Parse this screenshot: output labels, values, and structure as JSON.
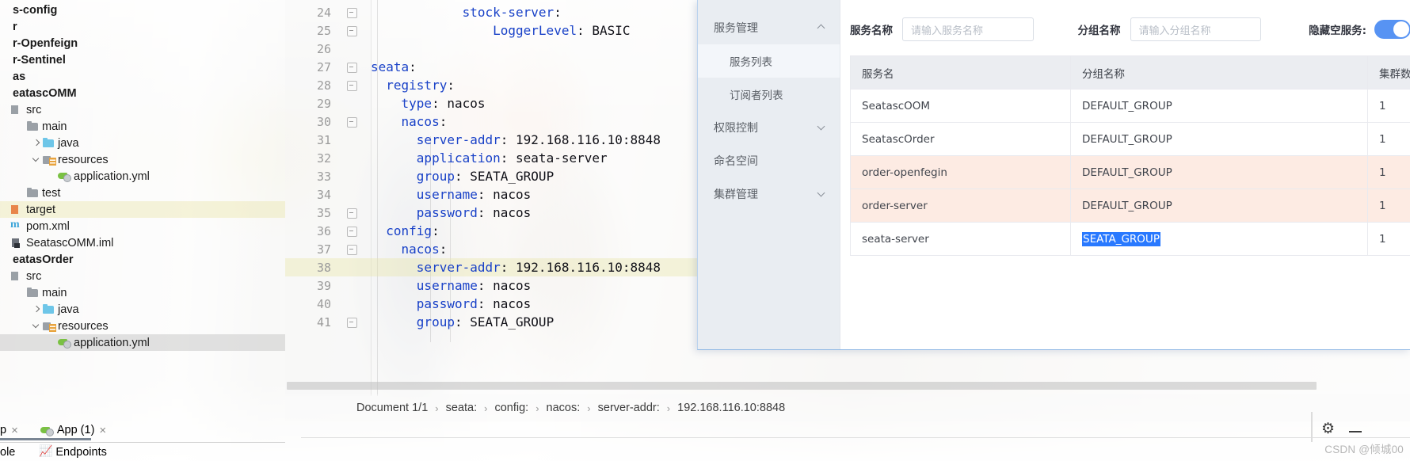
{
  "ide": {
    "project_tree": [
      {
        "label": "s-config",
        "indent": 0,
        "bold": true,
        "icon": "none",
        "chevron": "none",
        "state": "normal"
      },
      {
        "label": "r",
        "indent": 0,
        "bold": true,
        "icon": "none",
        "chevron": "none",
        "state": "normal"
      },
      {
        "label": "r-Openfeign",
        "indent": 0,
        "bold": true,
        "icon": "none",
        "chevron": "none",
        "state": "normal"
      },
      {
        "label": "r-Sentinel",
        "indent": 0,
        "bold": true,
        "icon": "none",
        "chevron": "none",
        "state": "normal"
      },
      {
        "label": "as",
        "indent": 0,
        "bold": true,
        "icon": "none",
        "chevron": "none",
        "state": "normal"
      },
      {
        "label": "eatascOMM",
        "indent": 0,
        "bold": true,
        "icon": "none",
        "chevron": "none",
        "state": "normal"
      },
      {
        "label": "src",
        "indent": 1,
        "bold": false,
        "icon": "src",
        "chevron": "none",
        "state": "normal"
      },
      {
        "label": "main",
        "indent": 2,
        "bold": false,
        "icon": "folder",
        "chevron": "none",
        "state": "normal"
      },
      {
        "label": "java",
        "indent": 3,
        "bold": false,
        "icon": "folder-blue",
        "chevron": "right",
        "state": "normal"
      },
      {
        "label": "resources",
        "indent": 3,
        "bold": false,
        "icon": "resources",
        "chevron": "down",
        "state": "normal"
      },
      {
        "label": "application.yml",
        "indent": 4,
        "bold": false,
        "icon": "yml",
        "chevron": "none",
        "state": "normal"
      },
      {
        "label": "test",
        "indent": 2,
        "bold": false,
        "icon": "folder",
        "chevron": "none",
        "state": "normal"
      },
      {
        "label": "target",
        "indent": 1,
        "bold": false,
        "icon": "target",
        "chevron": "none",
        "state": "highlight"
      },
      {
        "label": "pom.xml",
        "indent": 1,
        "bold": false,
        "icon": "xml",
        "chevron": "none",
        "state": "normal"
      },
      {
        "label": "SeatascOMM.iml",
        "indent": 1,
        "bold": false,
        "icon": "iml",
        "chevron": "none",
        "state": "normal"
      },
      {
        "label": "eatasOrder",
        "indent": 0,
        "bold": true,
        "icon": "none",
        "chevron": "none",
        "state": "normal"
      },
      {
        "label": "src",
        "indent": 1,
        "bold": false,
        "icon": "src",
        "chevron": "none",
        "state": "normal"
      },
      {
        "label": "main",
        "indent": 2,
        "bold": false,
        "icon": "folder",
        "chevron": "none",
        "state": "normal"
      },
      {
        "label": "java",
        "indent": 3,
        "bold": false,
        "icon": "folder-blue",
        "chevron": "right",
        "state": "normal"
      },
      {
        "label": "resources",
        "indent": 3,
        "bold": false,
        "icon": "resources",
        "chevron": "down",
        "state": "normal"
      },
      {
        "label": "application.yml",
        "indent": 4,
        "bold": false,
        "icon": "yml",
        "chevron": "none",
        "state": "selected"
      }
    ],
    "tab_bar": {
      "truncated_tab": "p",
      "app_tab": "App (1)",
      "close_glyph": "×"
    },
    "bottom_strip": {
      "left_label": "ole",
      "endpoints_label": "Endpoints"
    },
    "code_lines": [
      {
        "num": "24",
        "indent": 6,
        "text": "stock-server:",
        "key": "stock-server",
        "value": "",
        "fold": true,
        "highlight": false
      },
      {
        "num": "25",
        "indent": 8,
        "text": "LoggerLevel: BASIC",
        "key": "LoggerLevel",
        "value": " BASIC",
        "fold": true,
        "highlight": false
      },
      {
        "num": "26",
        "indent": 0,
        "text": "",
        "key": "",
        "value": "",
        "fold": false,
        "highlight": false
      },
      {
        "num": "27",
        "indent": 0,
        "text": "seata:",
        "key": "seata",
        "value": "",
        "fold": true,
        "highlight": false
      },
      {
        "num": "28",
        "indent": 1,
        "text": "registry:",
        "key": "registry",
        "value": "",
        "fold": true,
        "highlight": false
      },
      {
        "num": "29",
        "indent": 2,
        "text": "type: nacos",
        "key": "type",
        "value": " nacos",
        "fold": false,
        "highlight": false
      },
      {
        "num": "30",
        "indent": 2,
        "text": "nacos:",
        "key": "nacos",
        "value": "",
        "fold": true,
        "highlight": false
      },
      {
        "num": "31",
        "indent": 3,
        "text": "server-addr: 192.168.116.10:8848",
        "key": "server-addr",
        "value": " 192.168.116.10:8848",
        "fold": false,
        "highlight": false
      },
      {
        "num": "32",
        "indent": 3,
        "text": "application: seata-server",
        "key": "application",
        "value": " seata-server",
        "fold": false,
        "highlight": false
      },
      {
        "num": "33",
        "indent": 3,
        "text": "group: SEATA_GROUP",
        "key": "group",
        "value": " SEATA_GROUP",
        "fold": false,
        "highlight": false
      },
      {
        "num": "34",
        "indent": 3,
        "text": "username: nacos",
        "key": "username",
        "value": " nacos",
        "fold": false,
        "highlight": false
      },
      {
        "num": "35",
        "indent": 3,
        "text": "password: nacos",
        "key": "password",
        "value": " nacos",
        "fold": true,
        "highlight": false
      },
      {
        "num": "36",
        "indent": 1,
        "text": "config:",
        "key": "config",
        "value": "",
        "fold": true,
        "highlight": false
      },
      {
        "num": "37",
        "indent": 2,
        "text": "nacos:",
        "key": "nacos",
        "value": "",
        "fold": true,
        "highlight": false
      },
      {
        "num": "38",
        "indent": 3,
        "text": "server-addr: 192.168.116.10:8848",
        "key": "server-addr",
        "value": " 192.168.116.10:8848",
        "fold": false,
        "highlight": true
      },
      {
        "num": "39",
        "indent": 3,
        "text": "username: nacos",
        "key": "username",
        "value": " nacos",
        "fold": false,
        "highlight": false
      },
      {
        "num": "40",
        "indent": 3,
        "text": "password: nacos",
        "key": "password",
        "value": " nacos",
        "fold": false,
        "highlight": false
      },
      {
        "num": "41",
        "indent": 3,
        "text": "group: SEATA_GROUP",
        "key": "group",
        "value": " SEATA_GROUP",
        "fold": true,
        "highlight": false
      }
    ],
    "breadcrumb": {
      "separator": "›",
      "items": [
        "Document 1/1",
        "seata:",
        "config:",
        "nacos:",
        "server-addr:",
        "192.168.116.10:8848"
      ]
    },
    "watermark": "CSDN @倾城00"
  },
  "nacos": {
    "sidebar": [
      {
        "label": "服务管理",
        "type": "group",
        "caret": "up",
        "active": false
      },
      {
        "label": "服务列表",
        "type": "sub",
        "caret": "none",
        "active": true
      },
      {
        "label": "订阅者列表",
        "type": "sub",
        "caret": "none",
        "active": false
      },
      {
        "label": "权限控制",
        "type": "group",
        "caret": "down",
        "active": false
      },
      {
        "label": "命名空间",
        "type": "group",
        "caret": "none",
        "active": false
      },
      {
        "label": "集群管理",
        "type": "group",
        "caret": "down",
        "active": false
      }
    ],
    "search": {
      "service_name_label": "服务名称",
      "service_name_placeholder": "请输入服务名称",
      "service_name_value": "",
      "group_name_label": "分组名称",
      "group_name_placeholder": "请输入分组名称",
      "group_name_value": "",
      "hide_empty_label": "隐藏空服务:",
      "hide_empty_on": true,
      "toggle_color": "#5793f3"
    },
    "table": {
      "columns": [
        "服务名",
        "分组名称",
        "集群数目"
      ],
      "rows": [
        {
          "service": "SeatascOOM",
          "group": "DEFAULT_GROUP",
          "clusters": "1",
          "highlight": "none",
          "group_selected": false
        },
        {
          "service": "SeatascOrder",
          "group": "DEFAULT_GROUP",
          "clusters": "1",
          "highlight": "none",
          "group_selected": false
        },
        {
          "service": "order-openfegin",
          "group": "DEFAULT_GROUP",
          "clusters": "1",
          "highlight": "pink",
          "group_selected": false
        },
        {
          "service": "order-server",
          "group": "DEFAULT_GROUP",
          "clusters": "1",
          "highlight": "pink",
          "group_selected": false
        },
        {
          "service": "seata-server",
          "group": "SEATA_GROUP",
          "clusters": "1",
          "highlight": "none",
          "group_selected": true
        }
      ],
      "pink_row_color": "#fdebe3",
      "selection_color": "#2979ff"
    }
  }
}
